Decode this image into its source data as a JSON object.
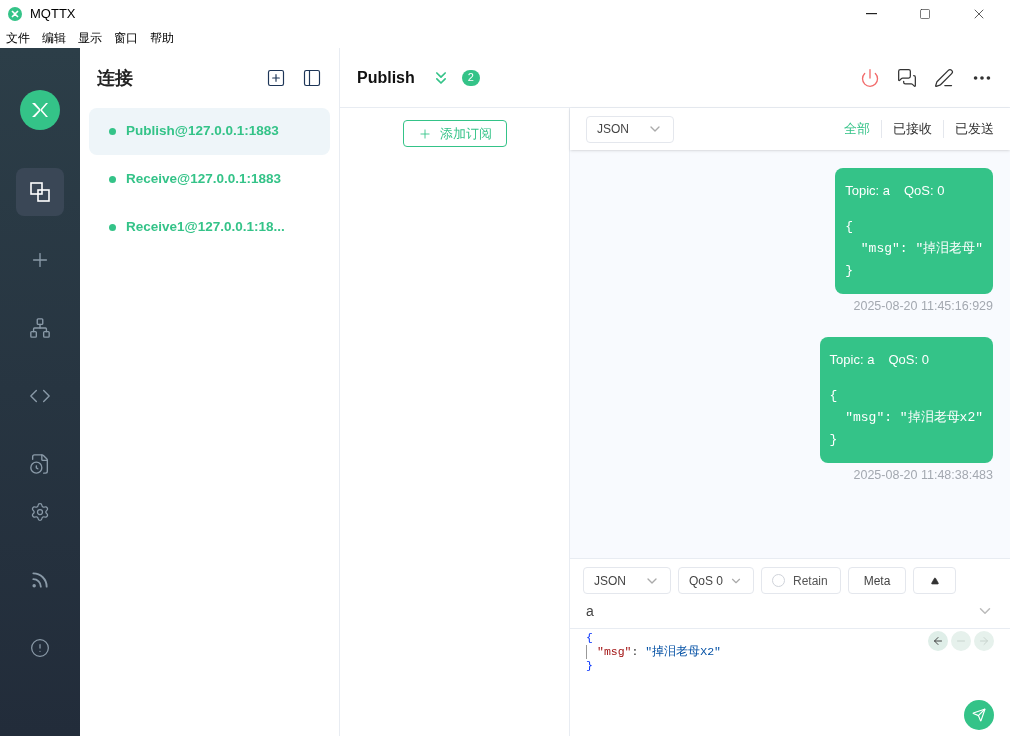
{
  "window": {
    "title": "MQTTX"
  },
  "menu": [
    "文件",
    "编辑",
    "显示",
    "窗口",
    "帮助"
  ],
  "nav": [
    {
      "kind": "connections",
      "selected": true
    },
    {
      "kind": "new",
      "selected": false
    },
    {
      "kind": "topology",
      "selected": false
    },
    {
      "kind": "script",
      "selected": false
    },
    {
      "kind": "log",
      "selected": false
    },
    {
      "kind": "settings",
      "selected": false
    },
    {
      "kind": "feed",
      "selected": false
    },
    {
      "kind": "about",
      "selected": false
    }
  ],
  "connections": {
    "title": "连接",
    "items": [
      {
        "name": "Publish@127.0.0.1:1883",
        "selected": true
      },
      {
        "name": "Receive@127.0.0.1:1883",
        "selected": false
      },
      {
        "name": "Receive1@127.0.0.1:18...",
        "selected": false
      }
    ]
  },
  "header": {
    "title": "Publish",
    "badge": "2"
  },
  "subscriptions": {
    "add_label": "添加订阅"
  },
  "messages_toolbar": {
    "format": "JSON",
    "filters": [
      {
        "label": "全部",
        "selected": true
      },
      {
        "label": "已接收",
        "selected": false
      },
      {
        "label": "已发送",
        "selected": false
      }
    ]
  },
  "messages": [
    {
      "topic": "Topic: a",
      "qos": "QoS: 0",
      "payload": [
        "{",
        "  \"msg\": \"掉泪老母\"",
        "}"
      ],
      "time": "2025-08-20 11:45:16:929"
    },
    {
      "topic": "Topic: a",
      "qos": "QoS: 0",
      "payload": [
        "{",
        "  \"msg\": \"掉泪老母x2\"",
        "}"
      ],
      "time": "2025-08-20 11:48:38:483"
    }
  ],
  "composer": {
    "format": "JSON",
    "qos": "QoS 0",
    "retain": {
      "label": "Retain",
      "checked": false
    },
    "meta": "Meta",
    "topic": "a",
    "payload": {
      "open": "{",
      "key": "\"msg\"",
      "colon": ":",
      "value": "\"掉泪老母X2\"",
      "close": "}"
    }
  }
}
